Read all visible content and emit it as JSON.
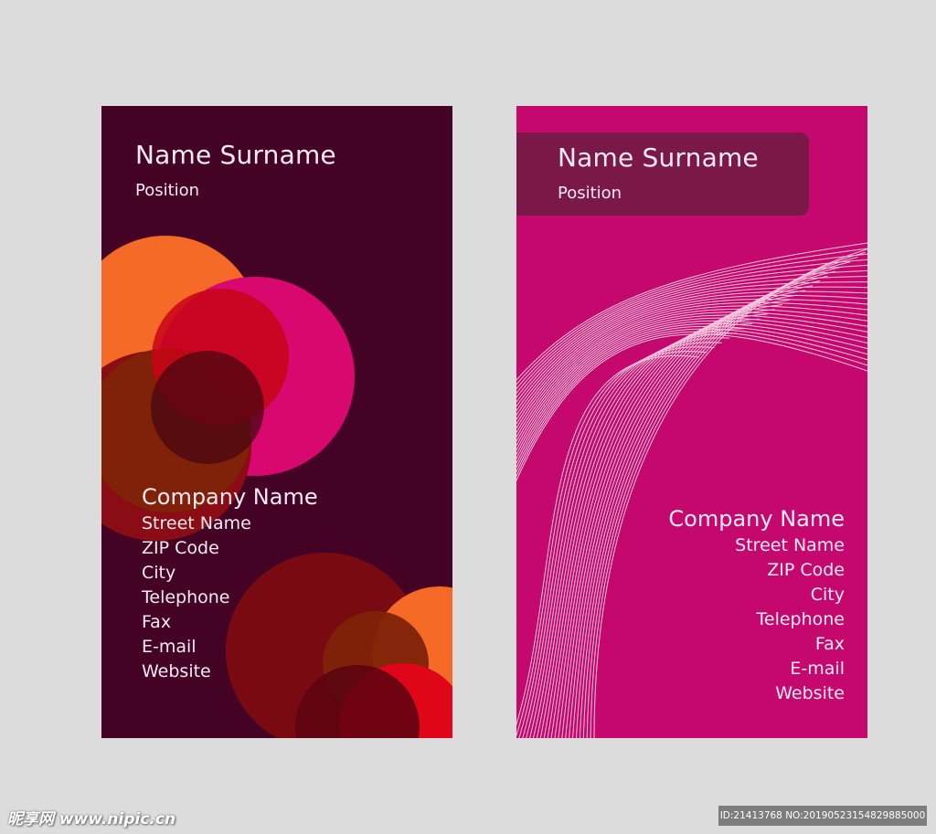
{
  "left_card": {
    "name": "Name Surname",
    "position": "Position",
    "company": "Company Name",
    "lines": [
      "Street Name",
      "ZIP Code",
      "City",
      "Telephone",
      "Fax",
      "E-mail",
      "Website"
    ]
  },
  "right_card": {
    "name": "Name Surname",
    "position": "Position",
    "company": "Company Name",
    "lines": [
      "Street Name",
      "ZIP Code",
      "City",
      "Telephone",
      "Fax",
      "E-mail",
      "Website"
    ]
  },
  "watermark": {
    "site": "昵享网 www.nipic.cn",
    "id": "ID:21413768 NO:20190523154829885000"
  },
  "colors": {
    "background": "#dcdcdc",
    "left_card": "#440324",
    "right_card": "#c4086e",
    "band": "#7a1848",
    "orange": "#f46a26",
    "pink": "#d8086e",
    "red": "#c80416",
    "dark_red": "#7a0a12"
  }
}
